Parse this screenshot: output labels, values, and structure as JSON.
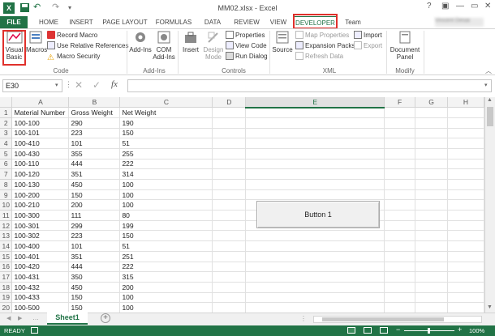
{
  "window": {
    "title": "MM02.xlsx - Excel",
    "help": "?",
    "minimize": "—",
    "restore": "▭",
    "close": "✕",
    "user": "Vincent Desai"
  },
  "tabs": [
    {
      "label": "FILE"
    },
    {
      "label": "HOME"
    },
    {
      "label": "INSERT"
    },
    {
      "label": "PAGE LAYOUT"
    },
    {
      "label": "FORMULAS"
    },
    {
      "label": "DATA"
    },
    {
      "label": "REVIEW"
    },
    {
      "label": "VIEW"
    },
    {
      "label": "DEVELOPER"
    },
    {
      "label": "Team"
    }
  ],
  "ribbon": {
    "code": {
      "label": "Code",
      "visual_basic_l1": "Visual",
      "visual_basic_l2": "Basic",
      "macros": "Macros",
      "record_macro": "Record Macro",
      "relative_refs": "Use Relative References",
      "macro_security": "Macro Security"
    },
    "addins": {
      "label": "Add-Ins",
      "addins_l1": "Add-Ins",
      "com_l1": "COM",
      "com_l2": "Add-Ins"
    },
    "controls": {
      "label": "Controls",
      "insert": "Insert",
      "design_l1": "Design",
      "design_l2": "Mode",
      "properties": "Properties",
      "view_code": "View Code",
      "run_dialog": "Run Dialog"
    },
    "xml": {
      "label": "XML",
      "source": "Source",
      "map_props": "Map Properties",
      "expansion": "Expansion Packs",
      "refresh": "Refresh Data",
      "import": "Import",
      "export": "Export"
    },
    "modify": {
      "label": "Modify",
      "doc_l1": "Document",
      "doc_l2": "Panel"
    }
  },
  "formula": {
    "namebox": "E30",
    "fx": "fx",
    "value": ""
  },
  "grid": {
    "columns": [
      "A",
      "B",
      "C",
      "D",
      "E",
      "F",
      "G",
      "H"
    ],
    "selected_column": "E",
    "rows": [
      [
        "Material Number",
        "Gross Weight",
        "Net Weight"
      ],
      [
        "100-100",
        "290",
        "190"
      ],
      [
        "100-101",
        "223",
        "150"
      ],
      [
        "100-410",
        "101",
        "51"
      ],
      [
        "100-430",
        "355",
        "255"
      ],
      [
        "100-110",
        "444",
        "222"
      ],
      [
        "100-120",
        "351",
        "314"
      ],
      [
        "100-130",
        "450",
        "100"
      ],
      [
        "100-200",
        "150",
        "100"
      ],
      [
        "100-210",
        "200",
        "100"
      ],
      [
        "100-300",
        "111",
        "80"
      ],
      [
        "100-301",
        "299",
        "199"
      ],
      [
        "100-302",
        "223",
        "150"
      ],
      [
        "100-400",
        "101",
        "51"
      ],
      [
        "100-401",
        "351",
        "251"
      ],
      [
        "100-420",
        "444",
        "222"
      ],
      [
        "100-431",
        "350",
        "315"
      ],
      [
        "100-432",
        "450",
        "200"
      ],
      [
        "100-433",
        "150",
        "100"
      ],
      [
        "100-500",
        "150",
        "100"
      ]
    ]
  },
  "button1": {
    "label": "Button 1"
  },
  "sheet": {
    "tab": "Sheet1",
    "add": "+"
  },
  "status": {
    "ready": "READY",
    "zoom": "100%",
    "minus": "−",
    "plus": "+"
  }
}
